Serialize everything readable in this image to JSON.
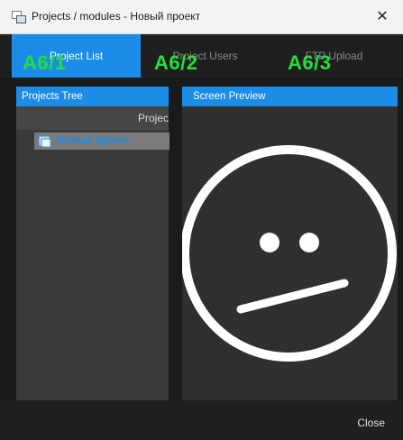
{
  "window": {
    "title": "Projects / modules - Новый проект",
    "close_symbol": "✕"
  },
  "tabs": [
    {
      "label": "Project List",
      "tag": "A6/1",
      "active": true
    },
    {
      "label": "Project Users",
      "tag": "A6/2",
      "active": false
    },
    {
      "label": "FTP Upload",
      "tag": "A6/3",
      "active": false
    }
  ],
  "tree": {
    "header": "Projects Tree",
    "column_header": "Projec",
    "items": [
      {
        "label": "Новый проект",
        "icon": "project-icon"
      }
    ]
  },
  "preview": {
    "header": "Screen Preview",
    "icon": "neutral-face-icon"
  },
  "footer": {
    "close_label": "Close"
  },
  "colors": {
    "accent": "#1b8ce8",
    "tag": "#22e03c",
    "panel": "#3a3a3a",
    "background": "#1a1a1a"
  }
}
